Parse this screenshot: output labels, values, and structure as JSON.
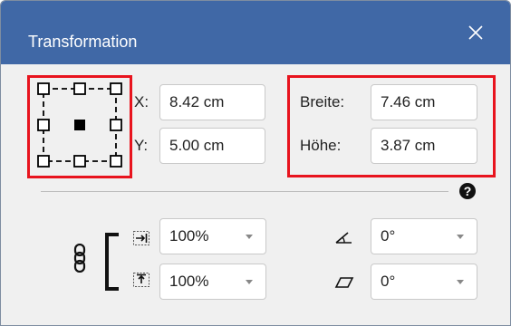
{
  "window": {
    "title": "Transformation",
    "accent_color": "#4068a6",
    "close_icon": "close-icon"
  },
  "position": {
    "x_label": "X:",
    "x_value": "8.42 cm",
    "y_label": "Y:",
    "y_value": "5.00 cm"
  },
  "size": {
    "width_label": "Breite:",
    "width_value": "7.46 cm",
    "height_label": "Höhe:",
    "height_value": "3.87 cm"
  },
  "reference_point": {
    "icon": "anchor-grid-icon",
    "selected": "center"
  },
  "help": {
    "icon": "help-icon"
  },
  "scale": {
    "link_icon": "chain-link-icon",
    "horizontal_icon": "horizontal-scale-icon",
    "horizontal_value": "100%",
    "vertical_icon": "vertical-scale-icon",
    "vertical_value": "100%"
  },
  "rotation": {
    "icon": "rotate-angle-icon",
    "value": "0°"
  },
  "skew": {
    "icon": "skew-icon",
    "value": "0°"
  },
  "highlight_color": "#e8141e"
}
